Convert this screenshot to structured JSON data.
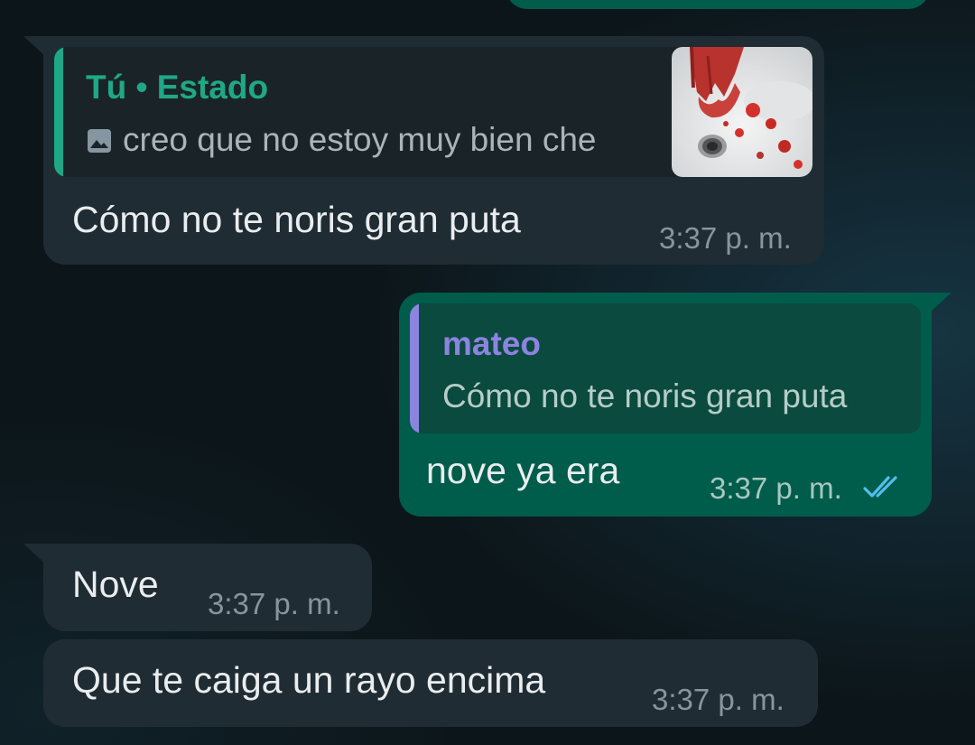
{
  "colors": {
    "incoming_bubble": "#202c33",
    "outgoing_bubble": "#005c4b",
    "status_accent": "#1fa886",
    "reply_accent": "#8b84e0",
    "read_ticks": "#53bdeb"
  },
  "messages": [
    {
      "direction": "incoming",
      "quote": {
        "author": "Tú • Estado",
        "icon": "image-icon",
        "text": "creo que no estoy muy bien che",
        "thumbnail": "hand-in-sink-photo"
      },
      "text": "Cómo no te noris gran puta",
      "time": "3:37 p. m."
    },
    {
      "direction": "outgoing",
      "quote": {
        "author": "mateo",
        "text": "Cómo no te noris gran puta"
      },
      "text": "nove ya era",
      "time": "3:37 p. m.",
      "status_icon": "double-check-icon",
      "status": "read"
    },
    {
      "direction": "incoming",
      "text": "Nove",
      "time": "3:37 p. m."
    },
    {
      "direction": "incoming",
      "text": "Que te caiga un rayo encima",
      "time": "3:37 p. m."
    }
  ]
}
